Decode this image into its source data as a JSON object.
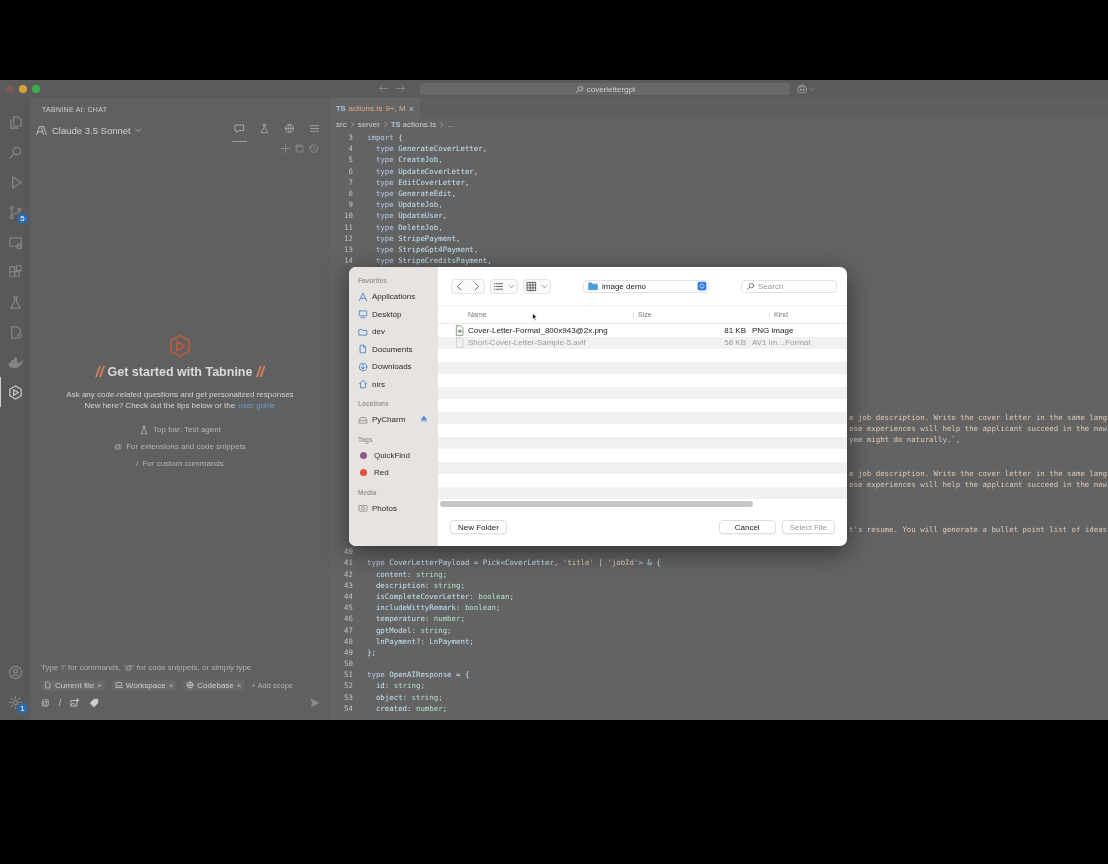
{
  "title_bar": {
    "search": "coverlettergpt"
  },
  "activity_bar": {
    "top": [
      {
        "kind": "files",
        "selected": false
      },
      {
        "kind": "search",
        "selected": false
      },
      {
        "kind": "run",
        "selected": false
      },
      {
        "kind": "git",
        "selected": false,
        "badge": "5"
      },
      {
        "kind": "remote",
        "selected": false
      },
      {
        "kind": "extensions",
        "selected": false
      },
      {
        "kind": "flask",
        "selected": false
      },
      {
        "kind": "filegear",
        "selected": false
      },
      {
        "kind": "whale",
        "selected": false
      },
      {
        "kind": "hexagon",
        "selected": true
      }
    ],
    "bottom": [
      {
        "kind": "account",
        "selected": false
      },
      {
        "kind": "gear",
        "selected": false,
        "badge": "1"
      }
    ]
  },
  "chat": {
    "header": "TABNINE AI: CHAT",
    "model": "Claude 3.5 Sonnet",
    "modes": [
      {
        "kind": "chat",
        "selected": true
      },
      {
        "kind": "flask",
        "selected": false
      },
      {
        "kind": "globe",
        "selected": false
      },
      {
        "kind": "menu",
        "selected": false
      }
    ],
    "actions": [
      {
        "kind": "plus"
      },
      {
        "kind": "copy"
      },
      {
        "kind": "history"
      }
    ],
    "mark_left": "//",
    "heading": "Get started with Tabnine",
    "mark_right": "//",
    "intro": "Ask any code-related questions and get personalized responses",
    "guide_text": "New here? Check out the tips below or the",
    "guide_link": "user guide",
    "tips": [
      {
        "kind": "flask",
        "text": "Top bar: Test agent"
      },
      {
        "kind": "char",
        "symbol": "@",
        "text": "For extensions and code snippets"
      },
      {
        "kind": "char",
        "symbol": "/",
        "text": "For custom commands"
      }
    ],
    "input": {
      "placeholder": "Type '/' for commands, '@' for code snippets, or simply type"
    },
    "scopes": [
      {
        "kind": "file",
        "label": "Current file",
        "remove": "×"
      },
      {
        "kind": "laptop",
        "label": "Workspace",
        "remove": "×"
      },
      {
        "kind": "globe",
        "label": "Codebase",
        "remove": "×"
      }
    ],
    "add_scope": "+ Add scope",
    "tools": [
      {
        "kind": "char",
        "symbol": "@"
      },
      {
        "kind": "char",
        "symbol": "/"
      },
      {
        "kind": "image"
      },
      {
        "kind": "tag"
      }
    ]
  },
  "editor": {
    "tab": {
      "lang": "TS",
      "name": "actions.ts",
      "status": "9+, M",
      "close": "×"
    },
    "breadcrumb": [
      {
        "text": "src"
      },
      {
        "text": "server"
      },
      {
        "lang": "TS",
        "text": "actions.ts"
      },
      {
        "text": "..."
      }
    ],
    "code_blocks": [
      {
        "lines": [
          {
            "number": "3",
            "text": "import {"
          },
          {
            "number": "4",
            "text": "  type GenerateCoverLetter,"
          },
          {
            "number": "5",
            "text": "  type CreateJob,"
          },
          {
            "number": "6",
            "text": "  type UpdateCoverLetter,"
          },
          {
            "number": "7",
            "text": "  type EditCoverLetter,"
          },
          {
            "number": "8",
            "text": "  type GenerateEdit,"
          },
          {
            "number": "9",
            "text": "  type UpdateJob,"
          },
          {
            "number": "10",
            "text": "  type UpdateUser,"
          },
          {
            "number": "11",
            "text": "  type DeleteJob,"
          },
          {
            "number": "12",
            "text": "  type StripePayment,"
          },
          {
            "number": "13",
            "text": "  type StripeGpt4Payment,"
          },
          {
            "number": "14",
            "text": "  type StripeCreditsPayment,"
          }
        ]
      },
      {
        "lines": [
          {
            "text": "e job description. Write the cover letter in the same lang"
          },
          {
            "text": "ose experiences will help the applicant succeed in the new"
          },
          {
            "text": "yee might do naturally.`,"
          }
        ]
      },
      {
        "lines": [
          {
            "text": "e job description. Write the cover letter in the same lang"
          },
          {
            "text": "ose experiences will help the applicant succeed in the new"
          }
        ]
      },
      {
        "lines": [
          {
            "text": "t's resume. You will generate a bullet point list of ideas"
          }
        ]
      },
      {
        "lines": [
          {
            "number": "40"
          },
          {
            "number": "41",
            "text": "type CoverLetterPayload = Pick<CoverLetter, 'title' | 'jobId'> & {"
          },
          {
            "number": "42",
            "text": "  content: string;"
          },
          {
            "number": "43",
            "text": "  description: string;"
          },
          {
            "number": "44",
            "text": "  isCompleteCoverLetter: boolean;"
          },
          {
            "number": "45",
            "text": "  includeWittyRemark: boolean;"
          },
          {
            "number": "46",
            "text": "  temperature: number;"
          },
          {
            "number": "47",
            "text": "  gptModel: string;"
          },
          {
            "number": "48",
            "text": "  lnPayment?: LnPayment;"
          },
          {
            "number": "49",
            "text": "};"
          },
          {
            "number": "50"
          },
          {
            "number": "51",
            "text": "type OpenAIResponse = {"
          },
          {
            "number": "52",
            "text": "  id: string;"
          },
          {
            "number": "53",
            "text": "  object: string;"
          },
          {
            "number": "54",
            "text": "  created: number;"
          }
        ]
      }
    ]
  },
  "dialog": {
    "sidebar": [
      {
        "title": "Favorites",
        "items": [
          {
            "kind": "apps",
            "label": "Applications"
          },
          {
            "kind": "desktop",
            "label": "Desktop"
          },
          {
            "kind": "folder",
            "label": "dev"
          },
          {
            "kind": "document",
            "label": "Documents"
          },
          {
            "kind": "download",
            "label": "Downloads"
          },
          {
            "kind": "home",
            "label": "nirs"
          }
        ]
      },
      {
        "title": "Locations",
        "items": [
          {
            "kind": "drive",
            "label": "PyCharm",
            "eject": true
          }
        ]
      },
      {
        "title": "Tags",
        "items": [
          {
            "kind": "tag",
            "label": "QuickFind",
            "color": "#8a5a8c"
          },
          {
            "kind": "tag",
            "label": "Red",
            "color": "#e0533f"
          }
        ]
      },
      {
        "title": "Media",
        "items": [
          {
            "kind": "camera",
            "label": "Photos"
          }
        ]
      }
    ],
    "path": "image demo",
    "search": {
      "placeholder": "Search"
    },
    "columns": [
      "Name",
      "Size",
      "Kind"
    ],
    "files": [
      {
        "name": "Cover-Letter-Format_800x943@2x.png",
        "size": "81 KB",
        "type": "PNG image",
        "disabled": false
      },
      {
        "name": "Short-Cover-Letter-Sample-5.avif",
        "size": "58 KB",
        "type": "AV1 im…Format",
        "disabled": true
      }
    ],
    "buttons": [
      {
        "label": "New Folder",
        "disabled": false
      },
      {
        "label": "Cancel",
        "disabled": false
      },
      {
        "label": "Select File",
        "disabled": true
      }
    ]
  }
}
